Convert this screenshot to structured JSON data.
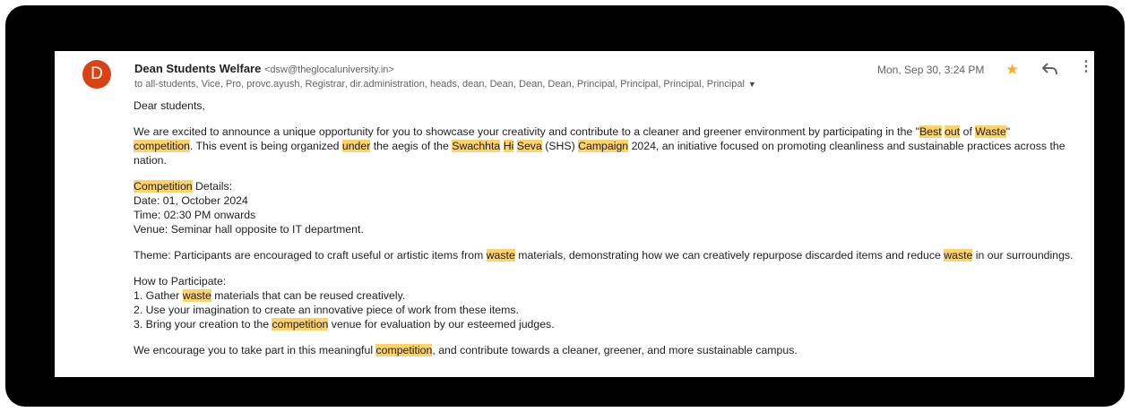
{
  "email": {
    "avatar_letter": "D",
    "sender_name": "Dean Students Welfare",
    "sender_email": "<dsw@theglocaluniversity.in>",
    "to_line": "to all-students, Vice, Pro, provc.ayush, Registrar, dir.administration, heads, dean, Dean, Dean, Dean, Principal, Principal, Principal, Principal",
    "date": "Mon, Sep 30, 3:24 PM",
    "icons": [
      "star-icon",
      "reply-icon",
      "more-vert-icon",
      "dropdown-caret-icon"
    ],
    "colors": {
      "avatar": "#d84315",
      "star": "#f6b026",
      "highlight": "#fcd36b",
      "frame": "#000000"
    }
  },
  "body": {
    "greeting": "Dear students,",
    "p1": {
      "t1": "We are excited to announce a unique opportunity for you to showcase your creativity and contribute to a cleaner and greener environment by participating in the \"",
      "h1": "Best",
      "t2": " ",
      "h2": "out",
      "t3": " of ",
      "h3": "Waste",
      "t4": "\"",
      "h4": "competition",
      "t5": ". This event is being organized ",
      "h5": "under",
      "t6": " the aegis of the ",
      "h6": "Swachhta",
      "t7": " ",
      "h7": "Hi",
      "t8": " ",
      "h8": "Seva",
      "t9": " (SHS) ",
      "h9": "Campaign",
      "t10": " 2024, an initiative focused on promoting cleanliness and sustainable practices across the nation."
    },
    "details": {
      "h1": "Competition",
      "t1": " Details:",
      "date": "Date: 01, October 2024",
      "time": "Time: 02:30 PM onwards",
      "venue": "Venue: Seminar hall opposite to IT department."
    },
    "theme": {
      "t1": "Theme: Participants are encouraged to craft useful or artistic items from ",
      "h1": "waste",
      "t2": " materials, demonstrating how we can creatively repurpose discarded items and reduce ",
      "h2": "waste",
      "t3": " in our surroundings."
    },
    "how": {
      "title": "How to Participate:",
      "s1a": "1. Gather ",
      "s1h": "waste",
      "s1b": " materials that can be reused creatively.",
      "s2": "2. Use your imagination to create an innovative piece of work from these items.",
      "s3a": "3. Bring your creation to the ",
      "s3h": "competition",
      "s3b": " venue for evaluation by our esteemed judges."
    },
    "closing": {
      "t1": "We encourage you to take part in this meaningful ",
      "h1": "competition",
      "t2": ", and contribute towards a cleaner, greener, and more sustainable campus."
    }
  }
}
